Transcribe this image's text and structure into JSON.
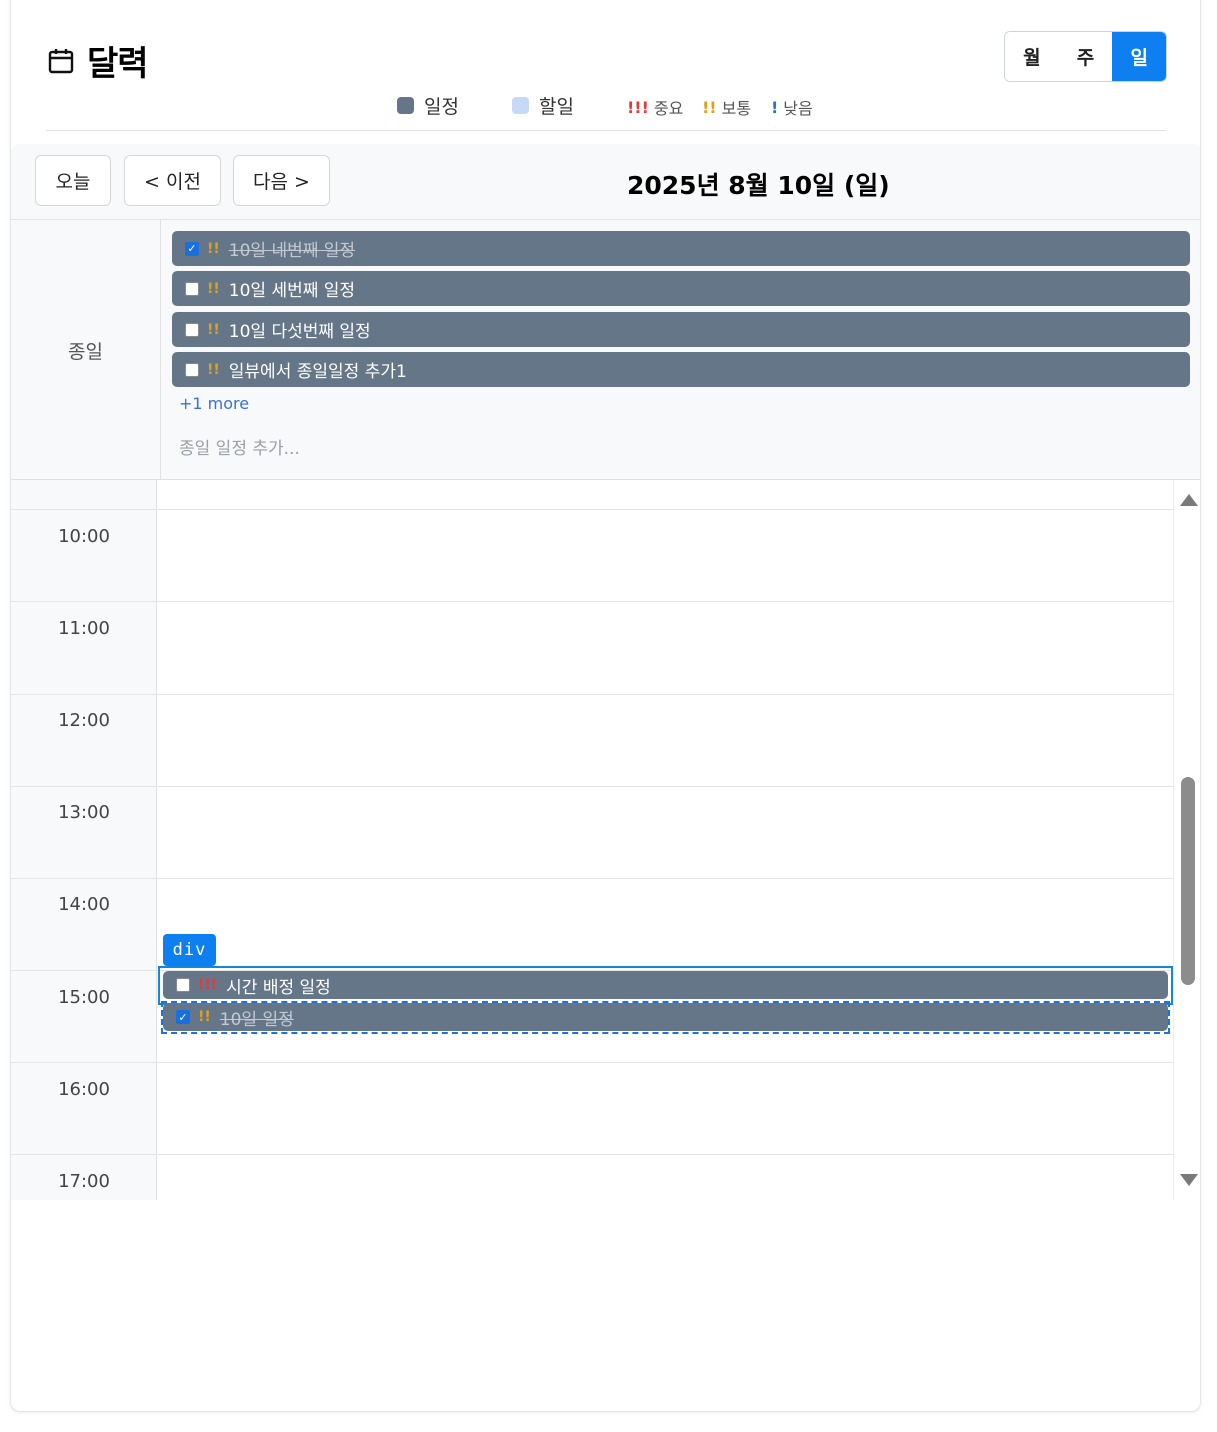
{
  "header": {
    "title": "달력",
    "views": [
      {
        "label": "월",
        "active": false
      },
      {
        "label": "주",
        "active": false
      },
      {
        "label": "일",
        "active": true
      }
    ]
  },
  "legend": {
    "event": {
      "label": "일정",
      "color": "#667689"
    },
    "todo": {
      "label": "할일",
      "color": "#c6daf7"
    },
    "priorities": [
      {
        "mark": "!!!",
        "label": "중요",
        "color": "#e03a3a"
      },
      {
        "mark": "!!",
        "label": "보통",
        "color": "#e0a11a"
      },
      {
        "mark": "!",
        "label": "낮음",
        "color": "#2a6fd8"
      }
    ]
  },
  "nav": {
    "today": "오늘",
    "prev": "< 이전",
    "next": "다음 >",
    "date": "2025년 8월 10일 (일)"
  },
  "allday": {
    "label": "종일",
    "events": [
      {
        "title": "10일 네번째 일정",
        "checked": true,
        "priority": "!!"
      },
      {
        "title": "10일 세번째 일정",
        "checked": false,
        "priority": "!!"
      },
      {
        "title": "10일 다섯번째 일정",
        "checked": false,
        "priority": "!!"
      },
      {
        "title": "일뷰에서 종일일정 추가1",
        "checked": false,
        "priority": "!!"
      }
    ],
    "more": "+1 more",
    "add_placeholder": "종일 일정 추가..."
  },
  "hours": [
    "10:00",
    "11:00",
    "12:00",
    "13:00",
    "14:00",
    "15:00",
    "16:00",
    "17:00"
  ],
  "timed_events": [
    {
      "title": "시간 배정 일정",
      "checked": false,
      "priority": "!!!"
    },
    {
      "title": "10일 일정",
      "checked": true,
      "priority": "!!"
    }
  ],
  "inspector_tag": "div"
}
